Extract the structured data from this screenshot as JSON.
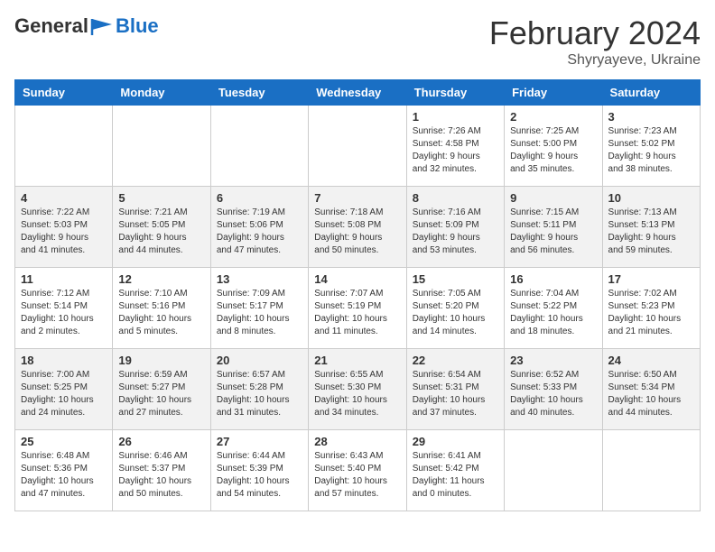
{
  "header": {
    "logo_line1": "General",
    "logo_line2": "Blue",
    "month_title": "February 2024",
    "location": "Shyryayeve, Ukraine"
  },
  "days_of_week": [
    "Sunday",
    "Monday",
    "Tuesday",
    "Wednesday",
    "Thursday",
    "Friday",
    "Saturday"
  ],
  "weeks": [
    [
      {
        "day": "",
        "info": ""
      },
      {
        "day": "",
        "info": ""
      },
      {
        "day": "",
        "info": ""
      },
      {
        "day": "",
        "info": ""
      },
      {
        "day": "1",
        "info": "Sunrise: 7:26 AM\nSunset: 4:58 PM\nDaylight: 9 hours\nand 32 minutes."
      },
      {
        "day": "2",
        "info": "Sunrise: 7:25 AM\nSunset: 5:00 PM\nDaylight: 9 hours\nand 35 minutes."
      },
      {
        "day": "3",
        "info": "Sunrise: 7:23 AM\nSunset: 5:02 PM\nDaylight: 9 hours\nand 38 minutes."
      }
    ],
    [
      {
        "day": "4",
        "info": "Sunrise: 7:22 AM\nSunset: 5:03 PM\nDaylight: 9 hours\nand 41 minutes."
      },
      {
        "day": "5",
        "info": "Sunrise: 7:21 AM\nSunset: 5:05 PM\nDaylight: 9 hours\nand 44 minutes."
      },
      {
        "day": "6",
        "info": "Sunrise: 7:19 AM\nSunset: 5:06 PM\nDaylight: 9 hours\nand 47 minutes."
      },
      {
        "day": "7",
        "info": "Sunrise: 7:18 AM\nSunset: 5:08 PM\nDaylight: 9 hours\nand 50 minutes."
      },
      {
        "day": "8",
        "info": "Sunrise: 7:16 AM\nSunset: 5:09 PM\nDaylight: 9 hours\nand 53 minutes."
      },
      {
        "day": "9",
        "info": "Sunrise: 7:15 AM\nSunset: 5:11 PM\nDaylight: 9 hours\nand 56 minutes."
      },
      {
        "day": "10",
        "info": "Sunrise: 7:13 AM\nSunset: 5:13 PM\nDaylight: 9 hours\nand 59 minutes."
      }
    ],
    [
      {
        "day": "11",
        "info": "Sunrise: 7:12 AM\nSunset: 5:14 PM\nDaylight: 10 hours\nand 2 minutes."
      },
      {
        "day": "12",
        "info": "Sunrise: 7:10 AM\nSunset: 5:16 PM\nDaylight: 10 hours\nand 5 minutes."
      },
      {
        "day": "13",
        "info": "Sunrise: 7:09 AM\nSunset: 5:17 PM\nDaylight: 10 hours\nand 8 minutes."
      },
      {
        "day": "14",
        "info": "Sunrise: 7:07 AM\nSunset: 5:19 PM\nDaylight: 10 hours\nand 11 minutes."
      },
      {
        "day": "15",
        "info": "Sunrise: 7:05 AM\nSunset: 5:20 PM\nDaylight: 10 hours\nand 14 minutes."
      },
      {
        "day": "16",
        "info": "Sunrise: 7:04 AM\nSunset: 5:22 PM\nDaylight: 10 hours\nand 18 minutes."
      },
      {
        "day": "17",
        "info": "Sunrise: 7:02 AM\nSunset: 5:23 PM\nDaylight: 10 hours\nand 21 minutes."
      }
    ],
    [
      {
        "day": "18",
        "info": "Sunrise: 7:00 AM\nSunset: 5:25 PM\nDaylight: 10 hours\nand 24 minutes."
      },
      {
        "day": "19",
        "info": "Sunrise: 6:59 AM\nSunset: 5:27 PM\nDaylight: 10 hours\nand 27 minutes."
      },
      {
        "day": "20",
        "info": "Sunrise: 6:57 AM\nSunset: 5:28 PM\nDaylight: 10 hours\nand 31 minutes."
      },
      {
        "day": "21",
        "info": "Sunrise: 6:55 AM\nSunset: 5:30 PM\nDaylight: 10 hours\nand 34 minutes."
      },
      {
        "day": "22",
        "info": "Sunrise: 6:54 AM\nSunset: 5:31 PM\nDaylight: 10 hours\nand 37 minutes."
      },
      {
        "day": "23",
        "info": "Sunrise: 6:52 AM\nSunset: 5:33 PM\nDaylight: 10 hours\nand 40 minutes."
      },
      {
        "day": "24",
        "info": "Sunrise: 6:50 AM\nSunset: 5:34 PM\nDaylight: 10 hours\nand 44 minutes."
      }
    ],
    [
      {
        "day": "25",
        "info": "Sunrise: 6:48 AM\nSunset: 5:36 PM\nDaylight: 10 hours\nand 47 minutes."
      },
      {
        "day": "26",
        "info": "Sunrise: 6:46 AM\nSunset: 5:37 PM\nDaylight: 10 hours\nand 50 minutes."
      },
      {
        "day": "27",
        "info": "Sunrise: 6:44 AM\nSunset: 5:39 PM\nDaylight: 10 hours\nand 54 minutes."
      },
      {
        "day": "28",
        "info": "Sunrise: 6:43 AM\nSunset: 5:40 PM\nDaylight: 10 hours\nand 57 minutes."
      },
      {
        "day": "29",
        "info": "Sunrise: 6:41 AM\nSunset: 5:42 PM\nDaylight: 11 hours\nand 0 minutes."
      },
      {
        "day": "",
        "info": ""
      },
      {
        "day": "",
        "info": ""
      }
    ]
  ]
}
